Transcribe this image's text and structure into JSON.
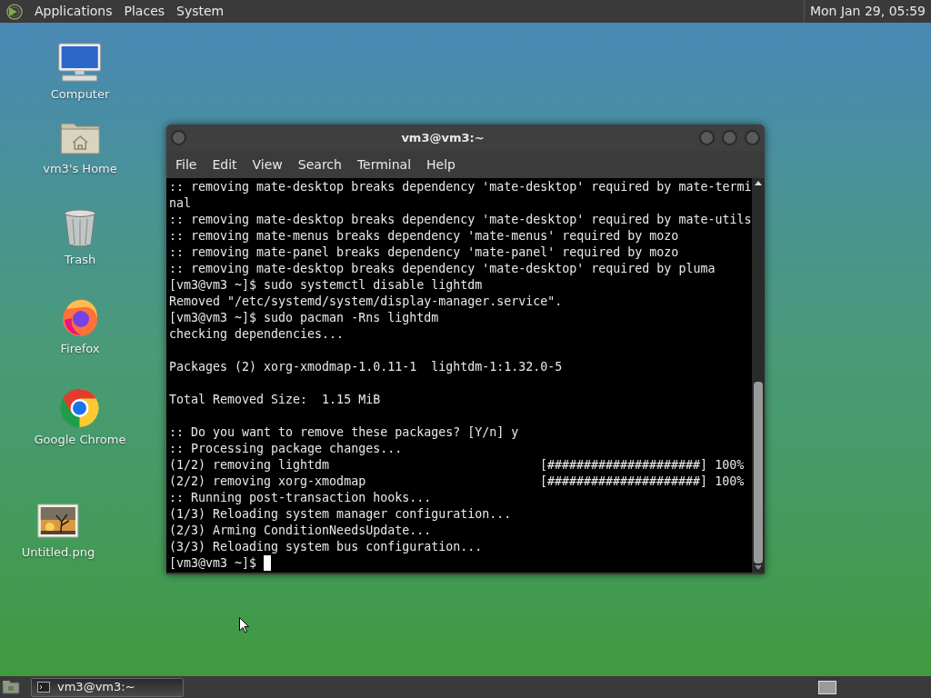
{
  "top_panel": {
    "menus": [
      "Applications",
      "Places",
      "System"
    ],
    "clock": "Mon Jan 29, 05:59"
  },
  "desktop_icons": [
    {
      "kind": "computer",
      "label": "Computer"
    },
    {
      "kind": "home",
      "label": "vm3's Home"
    },
    {
      "kind": "trash",
      "label": "Trash"
    },
    {
      "kind": "firefox",
      "label": "Firefox"
    },
    {
      "kind": "chrome",
      "label": "Google Chrome"
    },
    {
      "kind": "image",
      "label": "Untitled.png"
    }
  ],
  "terminal": {
    "title": "vm3@vm3:~",
    "menu": [
      "File",
      "Edit",
      "View",
      "Search",
      "Terminal",
      "Help"
    ],
    "lines": [
      {
        "text": ":: removing mate-desktop breaks dependency 'mate-desktop' required by mate-termi"
      },
      {
        "text": "nal"
      },
      {
        "text": ":: removing mate-desktop breaks dependency 'mate-desktop' required by mate-utils"
      },
      {
        "text": ":: removing mate-menus breaks dependency 'mate-menus' required by mozo"
      },
      {
        "text": ":: removing mate-panel breaks dependency 'mate-panel' required by mozo"
      },
      {
        "text": ":: removing mate-desktop breaks dependency 'mate-desktop' required by pluma"
      },
      {
        "text": "[vm3@vm3 ~]$ sudo systemctl disable lightdm"
      },
      {
        "text": "Removed \"/etc/systemd/system/display-manager.service\"."
      },
      {
        "text": "[vm3@vm3 ~]$ sudo pacman -Rns lightdm"
      },
      {
        "text": "checking dependencies..."
      },
      {
        "kind": "blank"
      },
      {
        "text": "Packages (2) xorg-xmodmap-1.0.11-1  lightdm-1:1.32.0-5"
      },
      {
        "kind": "blank"
      },
      {
        "text": "Total Removed Size:  1.15 MiB"
      },
      {
        "kind": "blank"
      },
      {
        "text": ":: Do you want to remove these packages? [Y/n] y"
      },
      {
        "text": ":: Processing package changes..."
      },
      {
        "kind": "progress",
        "text": "(1/2) removing lightdm",
        "bar": "[#####################]",
        "percent": "100%"
      },
      {
        "kind": "progress",
        "text": "(2/2) removing xorg-xmodmap",
        "bar": "[#####################]",
        "percent": "100%"
      },
      {
        "text": ":: Running post-transaction hooks..."
      },
      {
        "text": "(1/3) Reloading system manager configuration..."
      },
      {
        "text": "(2/3) Arming ConditionNeedsUpdate..."
      },
      {
        "text": "(3/3) Reloading system bus configuration..."
      },
      {
        "kind": "prompt",
        "text": "[vm3@vm3 ~]$"
      }
    ]
  },
  "taskbar": {
    "windows": [
      {
        "title": "vm3@vm3:~",
        "selected": true
      }
    ]
  }
}
